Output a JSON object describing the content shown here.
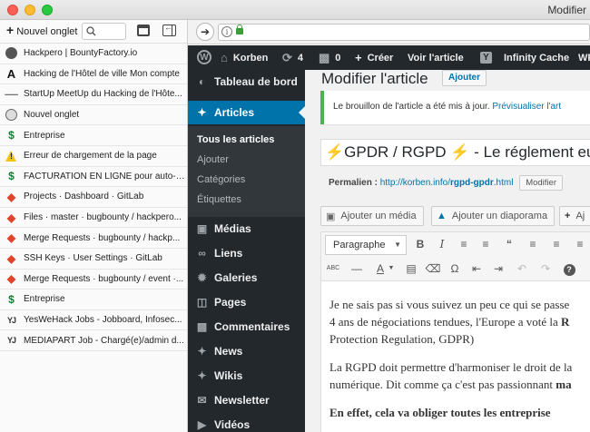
{
  "window": {
    "title": "Modifier"
  },
  "tabbar": {
    "new_tab_label": "Nouvel onglet",
    "tabs": [
      {
        "favicon": "bounty-icon",
        "label": "Hackpero | BountyFactory.io"
      },
      {
        "favicon": "letter-a-icon",
        "label": "Hacking de l'Hôtel de ville Mon compte"
      },
      {
        "favicon": "meetup-icon",
        "label": "StartUp MeetUp du Hacking de l'Hôte..."
      },
      {
        "favicon": "globe-icon",
        "label": "Nouvel onglet"
      },
      {
        "favicon": "money-icon",
        "label": "Entreprise"
      },
      {
        "favicon": "warning-icon",
        "label": "Erreur de chargement de la page"
      },
      {
        "favicon": "money-icon",
        "label": "FACTURATION EN LIGNE pour auto-e..."
      },
      {
        "favicon": "gitlab-icon",
        "label": "Projects · Dashboard · GitLab"
      },
      {
        "favicon": "gitlab-icon",
        "label": "Files · master · bugbounty / hackpero..."
      },
      {
        "favicon": "gitlab-icon",
        "label": "Merge Requests · bugbounty / hackp..."
      },
      {
        "favicon": "gitlab-icon",
        "label": "SSH Keys · User Settings · GitLab"
      },
      {
        "favicon": "gitlab-icon",
        "label": "Merge Requests · bugbounty / event ·..."
      },
      {
        "favicon": "money-icon",
        "label": "Entreprise"
      },
      {
        "favicon": "yeswehack-icon",
        "label": "YesWeHack Jobs - Jobboard, Infosec..."
      },
      {
        "favicon": "yeswehack-icon",
        "label": "MEDIAPART Job - Chargé(e)/admin d..."
      }
    ]
  },
  "adminbar": {
    "site_name": "Korben",
    "updates_count": "4",
    "comments_count": "0",
    "create_label": "Créer",
    "view_post_label": "Voir l'article",
    "cache_label": "Infinity Cache",
    "wp_label": "WP"
  },
  "adminmenu": {
    "dashboard": "Tableau de bord",
    "articles": "Articles",
    "sub": {
      "all": "Tous les articles",
      "add": "Ajouter",
      "categories": "Catégories",
      "tags": "Étiquettes"
    },
    "media": "Médias",
    "links": "Liens",
    "galleries": "Galeries",
    "pages": "Pages",
    "comments": "Commentaires",
    "news": "News",
    "wikis": "Wikis",
    "newsletter": "Newsletter",
    "videos": "Vidéos"
  },
  "editor": {
    "page_title": "Modifier l'article",
    "add_new_label": "Ajouter",
    "notice_text": "Le brouillon de l'article a été mis à jour.",
    "notice_link": "Prévisualiser l'art",
    "post_title": "⚡GPDR / RGPD ⚡ - Le réglement eu",
    "permalink_label": "Permalien :",
    "permalink_url_prefix": "http://korben.info/",
    "permalink_slug": "rgpd-gpdr",
    "permalink_url_suffix": ".html",
    "permalink_edit": "Modifier",
    "add_media": "Ajouter un média",
    "add_slideshow": "Ajouter un diaporama",
    "add_more": "Aj",
    "format_select": "Paragraphe",
    "body_line1": "Je ne sais pas si vous suivez un peu ce qui se passe",
    "body_line2a": "4 ans de négociations tendues, l'Europe a voté la ",
    "body_line2b": "R",
    "body_line3": "Protection Regulation, GDPR)",
    "body_line4": "La RGPD doit permettre d'harmoniser le droit de la",
    "body_line5a": "numérique. Dit comme ça c'est pas passionnant ",
    "body_line5b": "ma",
    "body_line6": "En effet, cela va obliger toutes les entreprise"
  }
}
